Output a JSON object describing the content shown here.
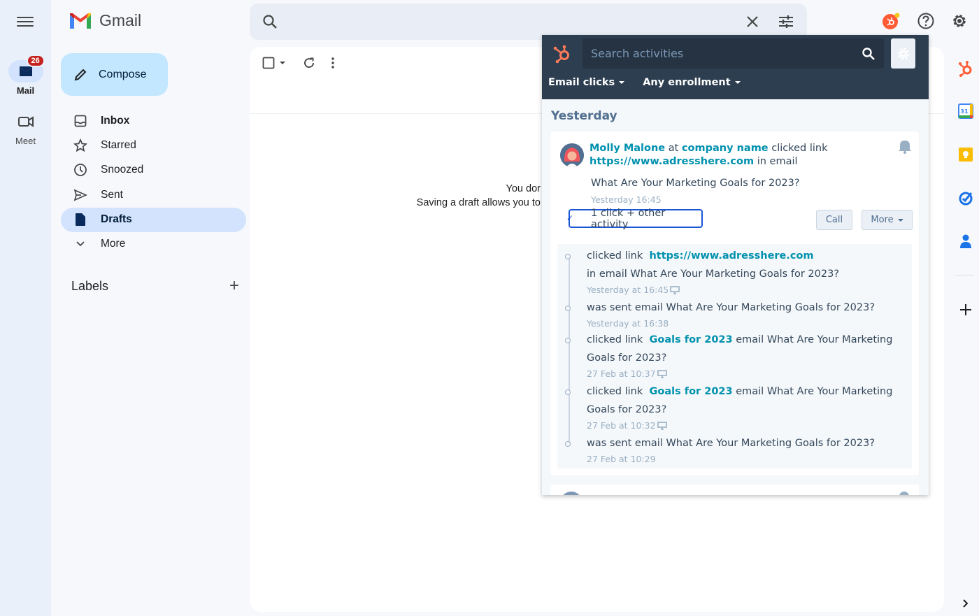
{
  "app": {
    "name": "Gmail"
  },
  "rail": {
    "items": [
      {
        "label": "Mail",
        "badge": "26",
        "icon": "mail-icon",
        "active": true
      },
      {
        "label": "Meet",
        "icon": "video-icon",
        "active": false
      }
    ]
  },
  "compose": {
    "label": "Compose"
  },
  "nav": {
    "items": [
      {
        "label": "Inbox",
        "icon": "inbox-icon"
      },
      {
        "label": "Starred",
        "icon": "star-icon"
      },
      {
        "label": "Snoozed",
        "icon": "clock-icon"
      },
      {
        "label": "Sent",
        "icon": "send-icon"
      },
      {
        "label": "Drafts",
        "icon": "draft-icon",
        "active": true
      },
      {
        "label": "More",
        "icon": "chevron-down-icon"
      }
    ],
    "labels_heading": "Labels"
  },
  "search": {
    "value": "",
    "placeholder": ""
  },
  "main": {
    "empty_line1": "You dor",
    "empty_line2": "Saving a draft allows you to"
  },
  "hubspot": {
    "search_placeholder": "Search activities",
    "filters": [
      "Email clicks",
      "Any enrollment"
    ],
    "day_heading": "Yesterday",
    "activity": {
      "contact": "Molly Malone",
      "at": "at",
      "company": "company name",
      "action": "clicked link",
      "url": "https://www.adresshere.com",
      "in_email": "in email",
      "subject": "What Are Your Marketing Goals for 2023?",
      "timestamp": "Yesterday 16:45",
      "expand_label": "1 click + other activity",
      "call_label": "Call",
      "more_label": "More"
    },
    "timeline": [
      {
        "prefix": "clicked link",
        "link": "https://www.adresshere.com",
        "text": "in email What Are Your Marketing Goals for 2023?",
        "time": "Yesterday at 16:45",
        "device": true
      },
      {
        "prefix": "was sent email What Are Your Marketing Goals for 2023?",
        "link": "",
        "text": "",
        "time": "Yesterday at 16:38",
        "device": false
      },
      {
        "prefix": "clicked link",
        "link": "Goals for 2023",
        "text": "email What Are Your Marketing Goals for 2023?",
        "time": "27 Feb at 10:37",
        "device": true
      },
      {
        "prefix": "clicked link",
        "link": "Goals for 2023",
        "text": "email What Are Your Marketing Goals for 2023?",
        "time": "27 Feb at 10:32",
        "device": true
      },
      {
        "prefix": "was sent email What Are Your Marketing Goals for 2023?",
        "link": "",
        "text": "",
        "time": "27 Feb at 10:29",
        "device": false
      }
    ]
  },
  "colors": {
    "hubspot_orange": "#ff5c35",
    "hubspot_dark": "#2d3e50",
    "link_teal": "#0091ae",
    "drafts_active": "#d3e3fd",
    "compose_bg": "#c2e7ff"
  }
}
